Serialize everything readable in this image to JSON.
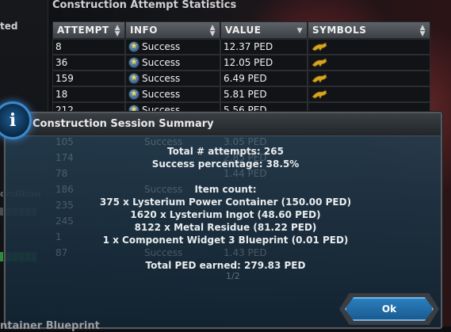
{
  "left_panel": {
    "label_top": "ted",
    "label_mid": "ondition"
  },
  "stats_window": {
    "title": "Construction Attempt Statistics",
    "columns": [
      {
        "label": "ATTEMPT"
      },
      {
        "label": "INFO"
      },
      {
        "label": "VALUE"
      },
      {
        "label": "SYMBOLS"
      }
    ],
    "rows": [
      {
        "attempt": "8",
        "info": "Success",
        "value": "12.37 PED"
      },
      {
        "attempt": "36",
        "info": "Success",
        "value": "12.05 PED"
      },
      {
        "attempt": "159",
        "info": "Success",
        "value": "6.49 PED"
      },
      {
        "attempt": "18",
        "info": "Success",
        "value": "5.81 PED"
      },
      {
        "attempt": "212",
        "info": "Success",
        "value": "5.56 PED"
      }
    ],
    "hidden_rows": [
      {
        "attempt": "105",
        "info": "Success",
        "value": "3.05 PED"
      },
      {
        "attempt": "174",
        "info": "Success",
        "value": "2.85 PED"
      },
      {
        "attempt": "78",
        "info": "Success",
        "value": "1.44 PED"
      },
      {
        "attempt": "186",
        "info": "Success",
        "value": ""
      },
      {
        "attempt": "235",
        "info": "",
        "value": ""
      },
      {
        "attempt": "245",
        "info": "",
        "value": ""
      },
      {
        "attempt": "1",
        "info": "",
        "value": ""
      },
      {
        "attempt": "87",
        "info": "Success",
        "value": "1.43 PED"
      }
    ],
    "pager": "1/2"
  },
  "dialog": {
    "title": "Construction Session Summary",
    "total_attempts": "Total # attempts: 265",
    "success_percentage": "Success percentage: 38.5%",
    "item_count_header": "Item count:",
    "items": [
      "375 x Lysterium Power Container (150.00 PED)",
      "1620 x Lysterium Ingot (48.60 PED)",
      "8122 x Metal Residue (81.22 PED)",
      "1 x Component Widget 3 Blueprint (0.01 PED)"
    ],
    "total_ped": "Total PED earned: 279.83 PED",
    "ok_label": "Ok"
  },
  "bottom_text": "ntainer Blueprint",
  "colors": {
    "accent": "#2b7fbf",
    "dialog_bg": "#1d3445",
    "symbol": "#d8a520"
  }
}
